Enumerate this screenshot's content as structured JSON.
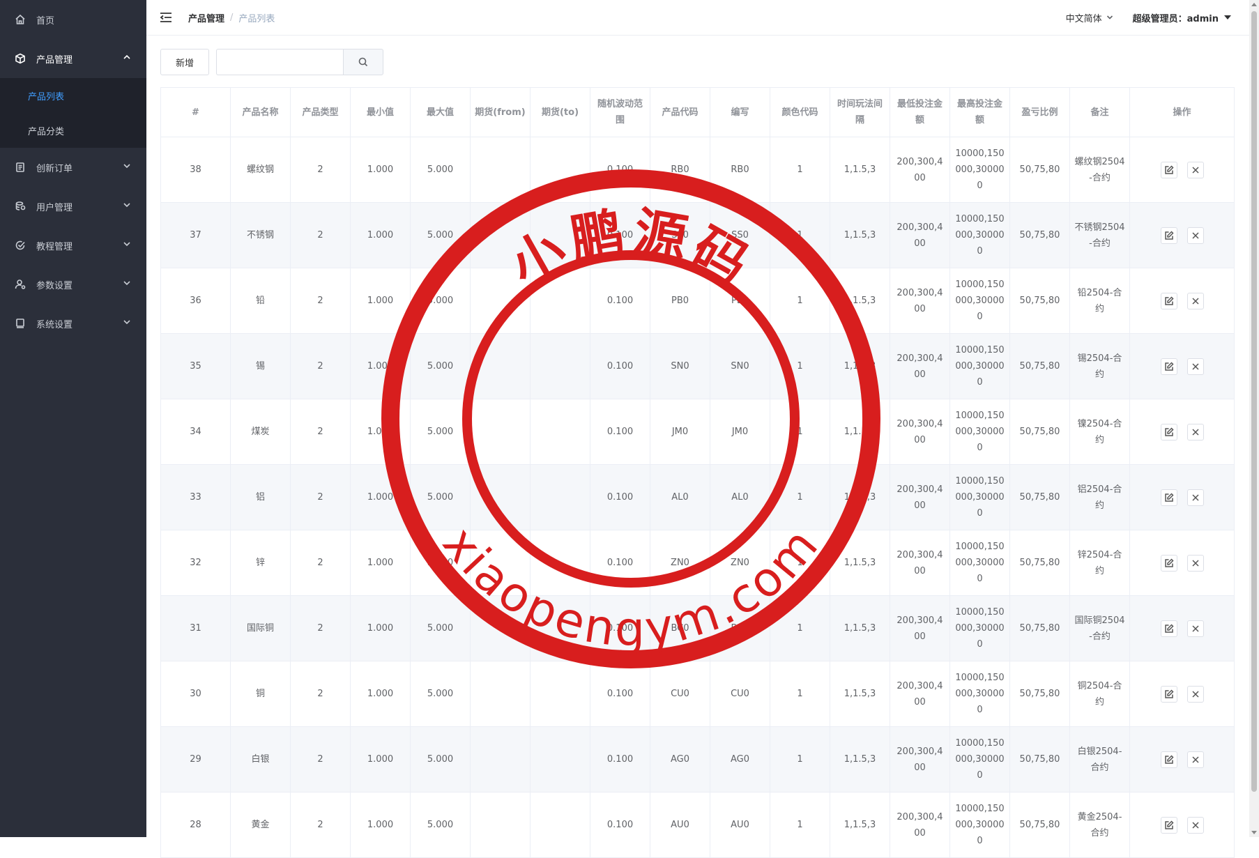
{
  "sidebar": {
    "items": [
      {
        "label": "首页",
        "icon": "home-icon"
      },
      {
        "label": "产品管理",
        "icon": "cube-icon",
        "expanded": true,
        "children": [
          {
            "label": "产品列表",
            "active": true
          },
          {
            "label": "产品分类"
          }
        ]
      },
      {
        "label": "创新订单",
        "icon": "order-icon"
      },
      {
        "label": "用户管理",
        "icon": "user-manage-icon"
      },
      {
        "label": "教程管理",
        "icon": "check-circle-icon"
      },
      {
        "label": "参数设置",
        "icon": "user-settings-icon"
      },
      {
        "label": "系统设置",
        "icon": "monitor-icon"
      }
    ],
    "active_color": "#409eff"
  },
  "header": {
    "breadcrumb": [
      "产品管理",
      "产品列表"
    ],
    "language": "中文简体",
    "user": "超级管理员：admin"
  },
  "toolbar": {
    "add_label": "新增",
    "search_placeholder": ""
  },
  "table": {
    "columns": [
      "#",
      "产品名称",
      "产品类型",
      "最小值",
      "最大值",
      "期货(from)",
      "期货(to)",
      "随机波动范围",
      "产品代码",
      "编写",
      "颜色代码",
      "时间玩法间隔",
      "最低投注金额",
      "最高投注金额",
      "盈亏比例",
      "备注",
      "操作"
    ],
    "rows": [
      [
        "38",
        "螺纹钢",
        "2",
        "1.000",
        "5.000",
        "",
        "",
        "0.100",
        "RB0",
        "RB0",
        "1",
        "1,1.5,3",
        "200,300,400",
        "10000,150000,300000",
        "50,75,80",
        "螺纹钢2504-合约"
      ],
      [
        "37",
        "不锈钢",
        "2",
        "1.000",
        "5.000",
        "",
        "",
        "0.100",
        "SS0",
        "SS0",
        "1",
        "1,1.5,3",
        "200,300,400",
        "10000,150000,300000",
        "50,75,80",
        "不锈钢2504-合约"
      ],
      [
        "36",
        "铅",
        "2",
        "1.000",
        "5.000",
        "",
        "",
        "0.100",
        "PB0",
        "PB0",
        "1",
        "1,1.5,3",
        "200,300,400",
        "10000,150000,300000",
        "50,75,80",
        "铅2504-合约"
      ],
      [
        "35",
        "锡",
        "2",
        "1.000",
        "5.000",
        "",
        "",
        "0.100",
        "SN0",
        "SN0",
        "1",
        "1,1.5,3",
        "200,300,400",
        "10000,150000,300000",
        "50,75,80",
        "锡2504-合约"
      ],
      [
        "34",
        "煤炭",
        "2",
        "1.000",
        "5.000",
        "",
        "",
        "0.100",
        "JM0",
        "JM0",
        "1",
        "1,1.5,3",
        "200,300,400",
        "10000,150000,300000",
        "50,75,80",
        "镍2504-合约"
      ],
      [
        "33",
        "铝",
        "2",
        "1.000",
        "5.000",
        "",
        "",
        "0.100",
        "AL0",
        "AL0",
        "1",
        "1,1.5,3",
        "200,300,400",
        "10000,150000,300000",
        "50,75,80",
        "铝2504-合约"
      ],
      [
        "32",
        "锌",
        "2",
        "1.000",
        "5.000",
        "",
        "",
        "0.100",
        "ZN0",
        "ZN0",
        "1",
        "1,1.5,3",
        "200,300,400",
        "10000,150000,300000",
        "50,75,80",
        "锌2504-合约"
      ],
      [
        "31",
        "国际铜",
        "2",
        "1.000",
        "5.000",
        "",
        "",
        "0.100",
        "BC0",
        "BC0",
        "1",
        "1,1.5,3",
        "200,300,400",
        "10000,150000,300000",
        "50,75,80",
        "国际铜2504-合约"
      ],
      [
        "30",
        "铜",
        "2",
        "1.000",
        "5.000",
        "",
        "",
        "0.100",
        "CU0",
        "CU0",
        "1",
        "1,1.5,3",
        "200,300,400",
        "10000,150000,300000",
        "50,75,80",
        "铜2504-合约"
      ],
      [
        "29",
        "白银",
        "2",
        "1.000",
        "5.000",
        "",
        "",
        "0.100",
        "AG0",
        "AG0",
        "1",
        "1,1.5,3",
        "200,300,400",
        "10000,150000,300000",
        "50,75,80",
        "白银2504-合约"
      ],
      [
        "28",
        "黄金",
        "2",
        "1.000",
        "5.000",
        "",
        "",
        "0.100",
        "AU0",
        "AU0",
        "1",
        "1,1.5,3",
        "200,300,400",
        "10000,150000,300000",
        "50,75,80",
        "黄金2504-合约"
      ]
    ],
    "actions": [
      "edit-icon",
      "close-icon"
    ]
  },
  "watermark": {
    "top_text": "小鹏源码",
    "bottom_text": "xiaopengym.com",
    "color": "#d81e1e"
  }
}
